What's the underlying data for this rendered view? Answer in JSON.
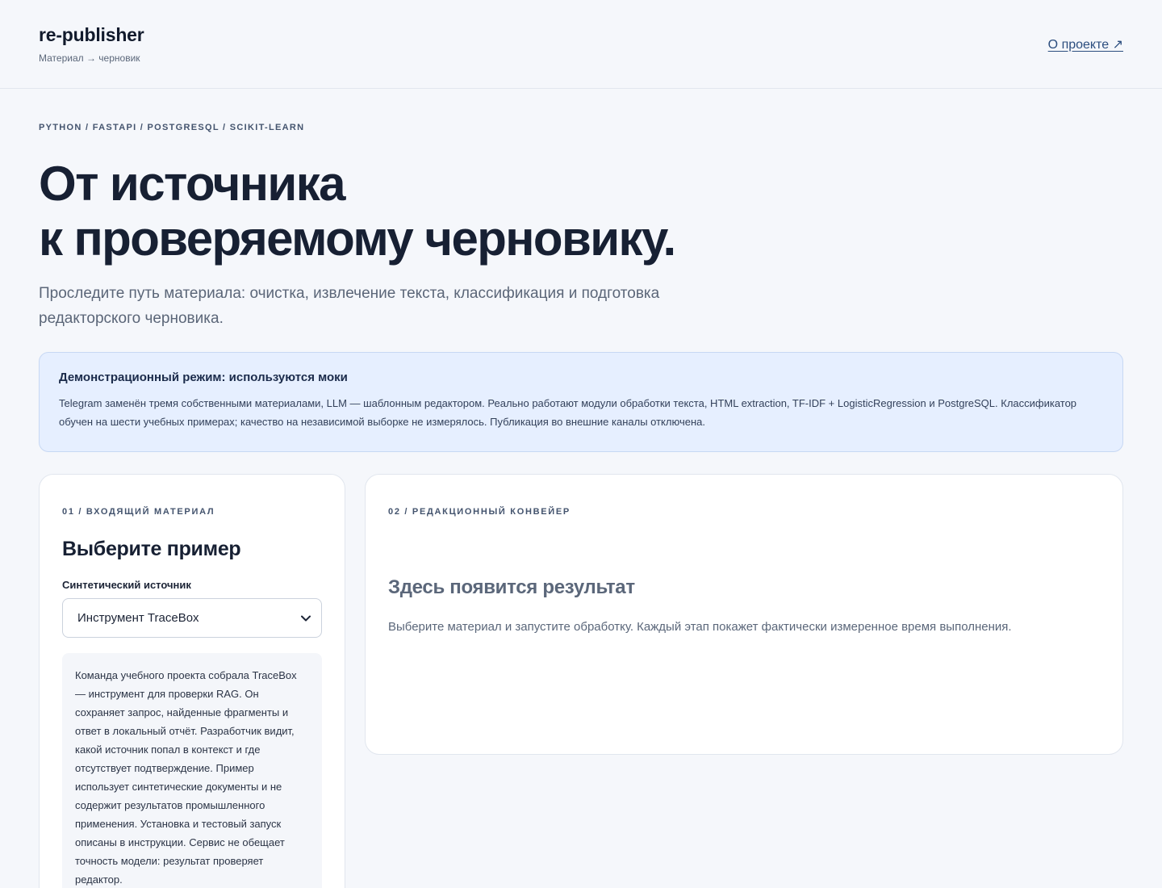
{
  "header": {
    "brand_name": "re-publisher",
    "brand_sub": "Материал → черновик",
    "about_link": "О проекте ↗"
  },
  "hero": {
    "kicker": "PYTHON / FASTAPI / POSTGRESQL / SCIKIT-LEARN",
    "title_line1": "От источника",
    "title_line2": "к проверяемому черновику.",
    "lead": "Проследите путь материала: очистка, извлечение текста, классификация и подготовка редакторского черновика."
  },
  "notice": {
    "title": "Демонстрационный режим: используются моки",
    "text": "Telegram заменён тремя собственными материалами, LLM — шаблонным редактором. Реально работают модули обработки текста, HTML extraction, TF-IDF + LogisticRegression и PostgreSQL. Классификатор обучен на шести учебных примерах; качество на независимой выборке не измерялось. Публикация во внешние каналы отключена."
  },
  "input_panel": {
    "kicker": "01 / ВХОДЯЩИЙ МАТЕРИАЛ",
    "title": "Выберите пример",
    "source_label": "Синтетический источник",
    "source_selected": "Инструмент TraceBox",
    "preview_text": "Команда учебного проекта собрала TraceBox — инструмент для проверки RAG. Он сохраняет запрос, найденные фрагменты и ответ в локальный отчёт. Разработчик видит, какой источник попал в контекст и где отсутствует подтверждение. Пример использует синтетические документы и не содержит результатов промышленного применения. Установка и тестовый запуск описаны в инструкции. Сервис не обещает точность модели: результат проверяет редактор."
  },
  "pipeline_panel": {
    "kicker": "02 / РЕДАКЦИОННЫЙ КОНВЕЙЕР",
    "empty_title": "Здесь появится результат",
    "empty_text": "Выберите материал и запустите обработку. Каждый этап покажет фактически измеренное время выполнения."
  }
}
